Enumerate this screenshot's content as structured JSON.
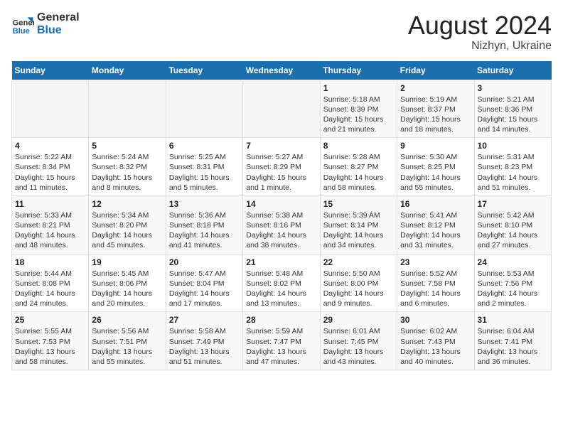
{
  "logo": {
    "line1": "General",
    "line2": "Blue"
  },
  "title": "August 2024",
  "location": "Nizhyn, Ukraine",
  "days_of_week": [
    "Sunday",
    "Monday",
    "Tuesday",
    "Wednesday",
    "Thursday",
    "Friday",
    "Saturday"
  ],
  "weeks": [
    [
      {
        "num": "",
        "info": ""
      },
      {
        "num": "",
        "info": ""
      },
      {
        "num": "",
        "info": ""
      },
      {
        "num": "",
        "info": ""
      },
      {
        "num": "1",
        "info": "Sunrise: 5:18 AM\nSunset: 8:39 PM\nDaylight: 15 hours\nand 21 minutes."
      },
      {
        "num": "2",
        "info": "Sunrise: 5:19 AM\nSunset: 8:37 PM\nDaylight: 15 hours\nand 18 minutes."
      },
      {
        "num": "3",
        "info": "Sunrise: 5:21 AM\nSunset: 8:36 PM\nDaylight: 15 hours\nand 14 minutes."
      }
    ],
    [
      {
        "num": "4",
        "info": "Sunrise: 5:22 AM\nSunset: 8:34 PM\nDaylight: 15 hours\nand 11 minutes."
      },
      {
        "num": "5",
        "info": "Sunrise: 5:24 AM\nSunset: 8:32 PM\nDaylight: 15 hours\nand 8 minutes."
      },
      {
        "num": "6",
        "info": "Sunrise: 5:25 AM\nSunset: 8:31 PM\nDaylight: 15 hours\nand 5 minutes."
      },
      {
        "num": "7",
        "info": "Sunrise: 5:27 AM\nSunset: 8:29 PM\nDaylight: 15 hours\nand 1 minute."
      },
      {
        "num": "8",
        "info": "Sunrise: 5:28 AM\nSunset: 8:27 PM\nDaylight: 14 hours\nand 58 minutes."
      },
      {
        "num": "9",
        "info": "Sunrise: 5:30 AM\nSunset: 8:25 PM\nDaylight: 14 hours\nand 55 minutes."
      },
      {
        "num": "10",
        "info": "Sunrise: 5:31 AM\nSunset: 8:23 PM\nDaylight: 14 hours\nand 51 minutes."
      }
    ],
    [
      {
        "num": "11",
        "info": "Sunrise: 5:33 AM\nSunset: 8:21 PM\nDaylight: 14 hours\nand 48 minutes."
      },
      {
        "num": "12",
        "info": "Sunrise: 5:34 AM\nSunset: 8:20 PM\nDaylight: 14 hours\nand 45 minutes."
      },
      {
        "num": "13",
        "info": "Sunrise: 5:36 AM\nSunset: 8:18 PM\nDaylight: 14 hours\nand 41 minutes."
      },
      {
        "num": "14",
        "info": "Sunrise: 5:38 AM\nSunset: 8:16 PM\nDaylight: 14 hours\nand 38 minutes."
      },
      {
        "num": "15",
        "info": "Sunrise: 5:39 AM\nSunset: 8:14 PM\nDaylight: 14 hours\nand 34 minutes."
      },
      {
        "num": "16",
        "info": "Sunrise: 5:41 AM\nSunset: 8:12 PM\nDaylight: 14 hours\nand 31 minutes."
      },
      {
        "num": "17",
        "info": "Sunrise: 5:42 AM\nSunset: 8:10 PM\nDaylight: 14 hours\nand 27 minutes."
      }
    ],
    [
      {
        "num": "18",
        "info": "Sunrise: 5:44 AM\nSunset: 8:08 PM\nDaylight: 14 hours\nand 24 minutes."
      },
      {
        "num": "19",
        "info": "Sunrise: 5:45 AM\nSunset: 8:06 PM\nDaylight: 14 hours\nand 20 minutes."
      },
      {
        "num": "20",
        "info": "Sunrise: 5:47 AM\nSunset: 8:04 PM\nDaylight: 14 hours\nand 17 minutes."
      },
      {
        "num": "21",
        "info": "Sunrise: 5:48 AM\nSunset: 8:02 PM\nDaylight: 14 hours\nand 13 minutes."
      },
      {
        "num": "22",
        "info": "Sunrise: 5:50 AM\nSunset: 8:00 PM\nDaylight: 14 hours\nand 9 minutes."
      },
      {
        "num": "23",
        "info": "Sunrise: 5:52 AM\nSunset: 7:58 PM\nDaylight: 14 hours\nand 6 minutes."
      },
      {
        "num": "24",
        "info": "Sunrise: 5:53 AM\nSunset: 7:56 PM\nDaylight: 14 hours\nand 2 minutes."
      }
    ],
    [
      {
        "num": "25",
        "info": "Sunrise: 5:55 AM\nSunset: 7:53 PM\nDaylight: 13 hours\nand 58 minutes."
      },
      {
        "num": "26",
        "info": "Sunrise: 5:56 AM\nSunset: 7:51 PM\nDaylight: 13 hours\nand 55 minutes."
      },
      {
        "num": "27",
        "info": "Sunrise: 5:58 AM\nSunset: 7:49 PM\nDaylight: 13 hours\nand 51 minutes."
      },
      {
        "num": "28",
        "info": "Sunrise: 5:59 AM\nSunset: 7:47 PM\nDaylight: 13 hours\nand 47 minutes."
      },
      {
        "num": "29",
        "info": "Sunrise: 6:01 AM\nSunset: 7:45 PM\nDaylight: 13 hours\nand 43 minutes."
      },
      {
        "num": "30",
        "info": "Sunrise: 6:02 AM\nSunset: 7:43 PM\nDaylight: 13 hours\nand 40 minutes."
      },
      {
        "num": "31",
        "info": "Sunrise: 6:04 AM\nSunset: 7:41 PM\nDaylight: 13 hours\nand 36 minutes."
      }
    ]
  ]
}
